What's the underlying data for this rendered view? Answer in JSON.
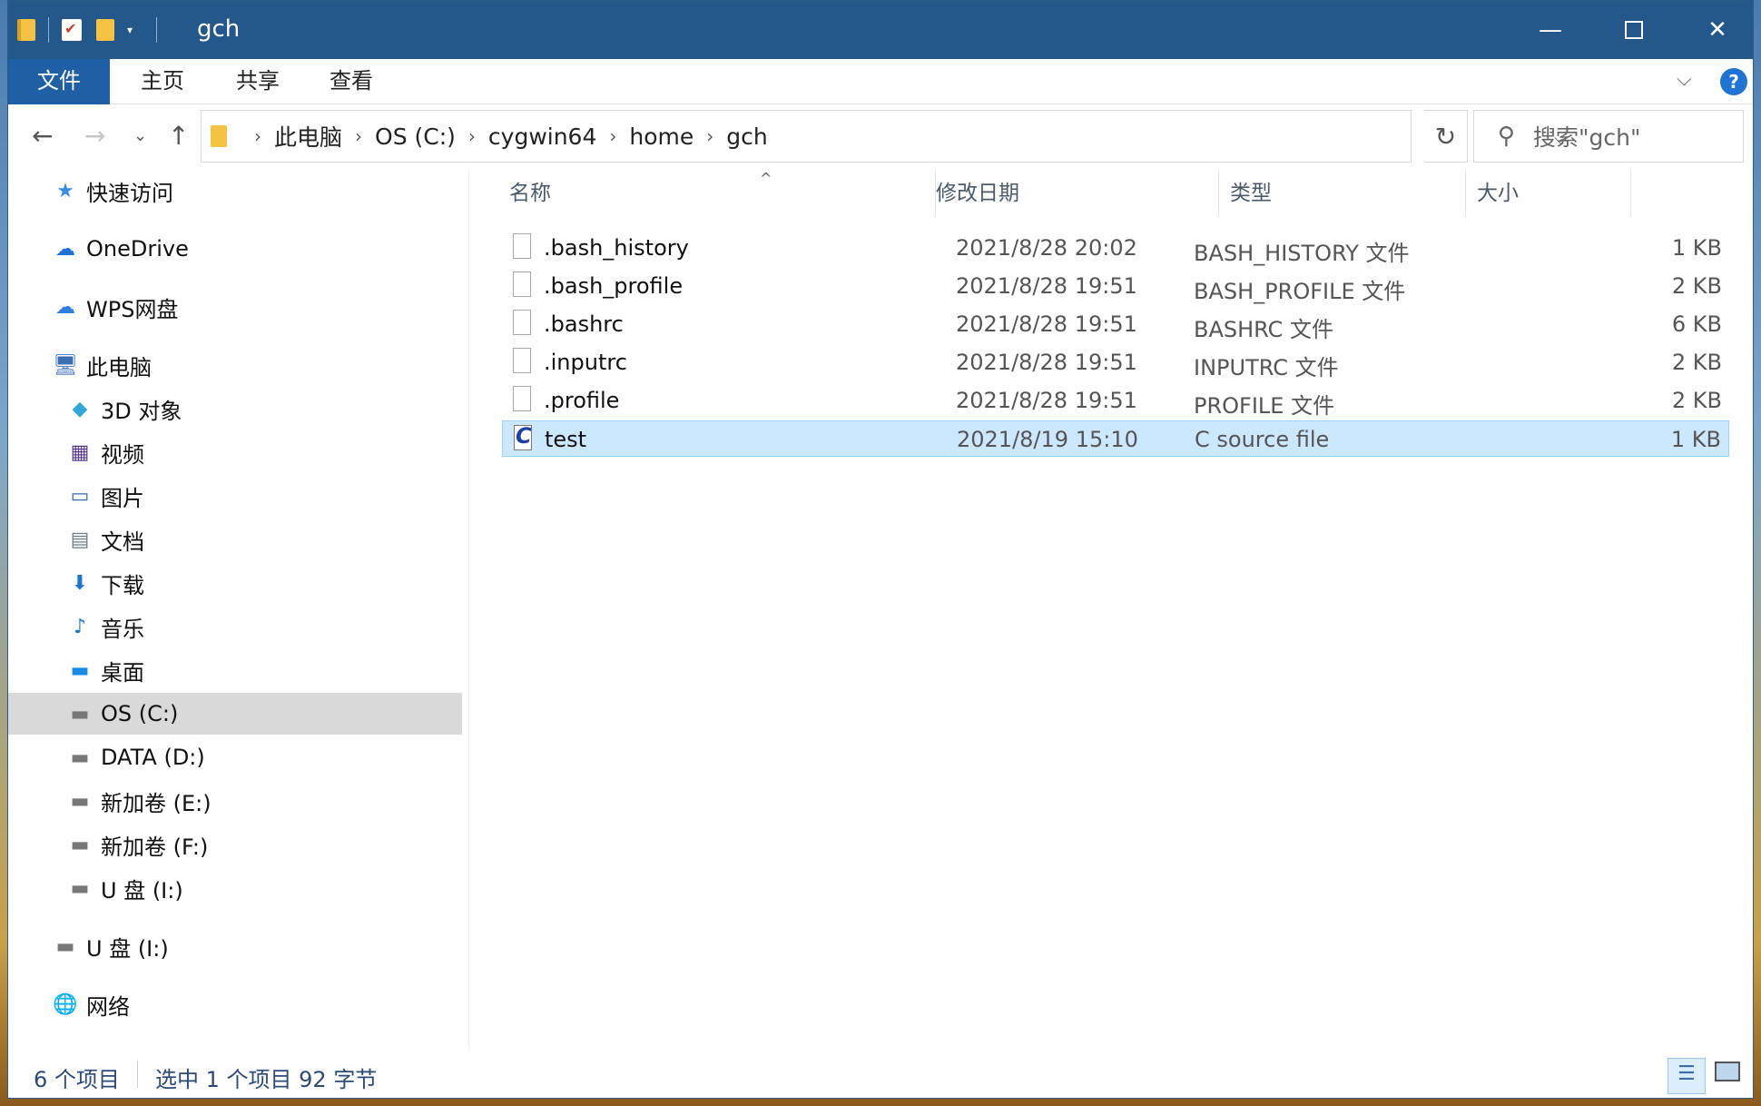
{
  "window": {
    "title": "gch",
    "controls": {
      "minimize": "—",
      "maximize": "",
      "close": "✕"
    }
  },
  "ribbon": {
    "tabs": [
      "文件",
      "主页",
      "共享",
      "查看"
    ],
    "help": "?"
  },
  "nav": {
    "back": "←",
    "forward": "→",
    "recent": "⌄",
    "up": "↑",
    "breadcrumb": [
      "此电脑",
      "OS (C:)",
      "cygwin64",
      "home",
      "gch"
    ],
    "refresh": "↻",
    "search_placeholder": "搜索\"gch\""
  },
  "sidebar": {
    "items": [
      {
        "label": "快速访问",
        "icon": "★",
        "icon_name": "star-icon",
        "level": 1
      },
      {
        "label": "OneDrive",
        "icon": "☁",
        "icon_name": "cloud-icon",
        "level": 1
      },
      {
        "label": "WPS网盘",
        "icon": "☁",
        "icon_name": "wps-cloud-icon",
        "level": 1
      },
      {
        "label": "此电脑",
        "icon": "🖥",
        "icon_name": "computer-icon",
        "level": 1
      },
      {
        "label": "3D 对象",
        "icon": "◆",
        "icon_name": "3d-objects-icon",
        "level": 2
      },
      {
        "label": "视频",
        "icon": "▦",
        "icon_name": "video-icon",
        "level": 2
      },
      {
        "label": "图片",
        "icon": "▭",
        "icon_name": "pictures-icon",
        "level": 2
      },
      {
        "label": "文档",
        "icon": "▤",
        "icon_name": "documents-icon",
        "level": 2
      },
      {
        "label": "下载",
        "icon": "⬇",
        "icon_name": "downloads-icon",
        "level": 2
      },
      {
        "label": "音乐",
        "icon": "♪",
        "icon_name": "music-icon",
        "level": 2
      },
      {
        "label": "桌面",
        "icon": "▬",
        "icon_name": "desktop-icon",
        "level": 2
      },
      {
        "label": "OS (C:)",
        "icon": "▬",
        "icon_name": "drive-icon",
        "level": 2
      },
      {
        "label": "DATA (D:)",
        "icon": "▬",
        "icon_name": "drive-icon",
        "level": 2
      },
      {
        "label": "新加卷 (E:)",
        "icon": "▬",
        "icon_name": "drive-icon",
        "level": 2
      },
      {
        "label": "新加卷 (F:)",
        "icon": "▬",
        "icon_name": "drive-icon",
        "level": 2
      },
      {
        "label": "U 盘 (I:)",
        "icon": "▬",
        "icon_name": "usb-drive-icon",
        "level": 2
      },
      {
        "label": "U 盘 (I:)",
        "icon": "▬",
        "icon_name": "usb-drive-icon",
        "level": 1
      },
      {
        "label": "网络",
        "icon": "🌐",
        "icon_name": "network-icon",
        "level": 1
      }
    ],
    "selected_index": 11
  },
  "files": {
    "columns": {
      "name": "名称",
      "date": "修改日期",
      "type": "类型",
      "size": "大小"
    },
    "sort_indicator": "^",
    "rows": [
      {
        "name": ".bash_history",
        "date": "2021/8/28 20:02",
        "type": "BASH_HISTORY 文件",
        "size": "1 KB",
        "icon": "file-icon"
      },
      {
        "name": ".bash_profile",
        "date": "2021/8/28 19:51",
        "type": "BASH_PROFILE 文件",
        "size": "2 KB",
        "icon": "file-icon"
      },
      {
        "name": ".bashrc",
        "date": "2021/8/28 19:51",
        "type": "BASHRC 文件",
        "size": "6 KB",
        "icon": "file-icon"
      },
      {
        "name": ".inputrc",
        "date": "2021/8/28 19:51",
        "type": "INPUTRC 文件",
        "size": "2 KB",
        "icon": "file-icon"
      },
      {
        "name": ".profile",
        "date": "2021/8/28 19:51",
        "type": "PROFILE 文件",
        "size": "2 KB",
        "icon": "file-icon"
      },
      {
        "name": "test",
        "date": "2021/8/19 15:10",
        "type": "C source file",
        "size": "1 KB",
        "icon": "c-source-icon"
      }
    ],
    "selected_index": 5
  },
  "status": {
    "count": "6 个项目",
    "selection": "选中 1 个项目  92 字节"
  }
}
